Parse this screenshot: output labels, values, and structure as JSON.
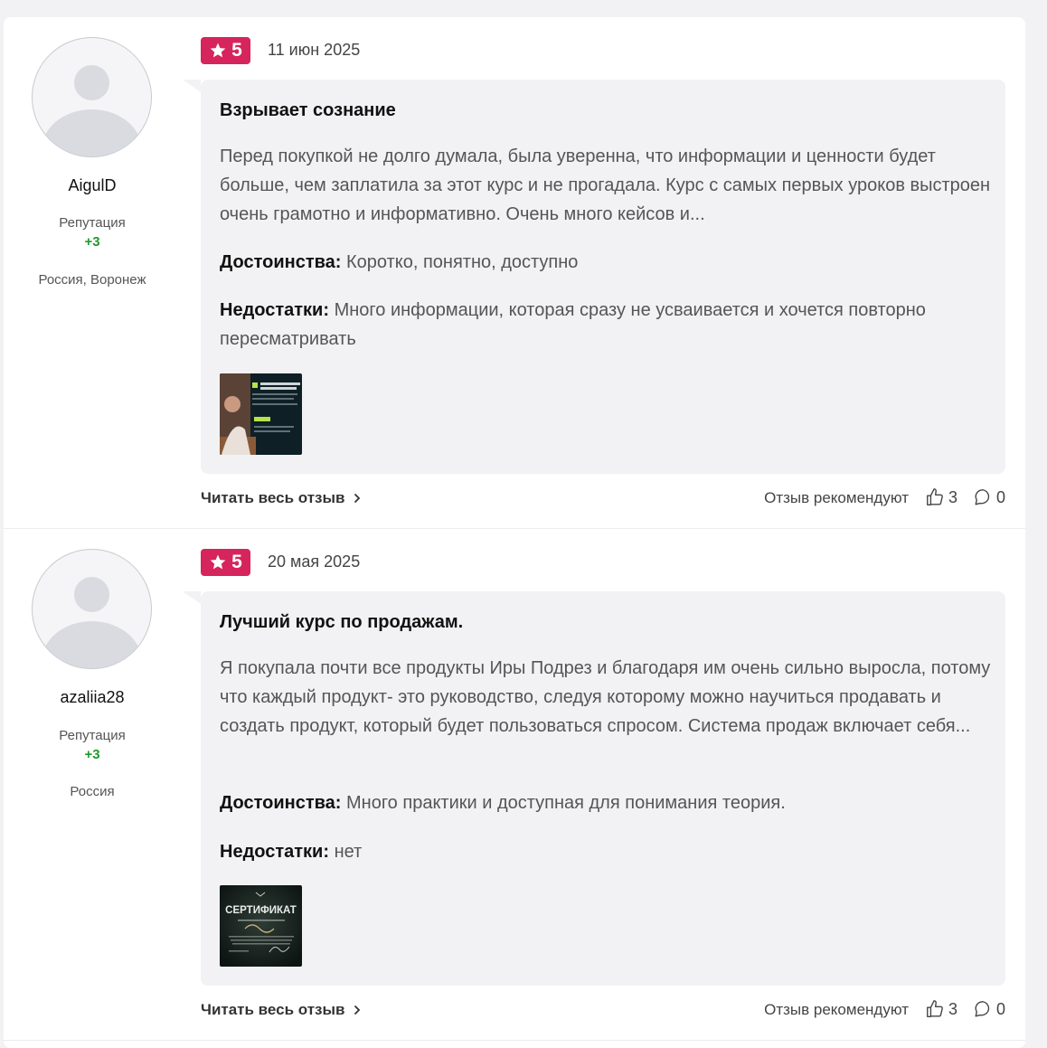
{
  "reviews": [
    {
      "author": {
        "name": "AigulD",
        "reputation_label": "Репутация",
        "reputation_value": "+3",
        "location": "Россия, Воронеж"
      },
      "rating": "5",
      "date": "11 июн 2025",
      "title": "Взрывает сознание",
      "text": "Перед покупкой не долго думала, была уверенна, что информации и ценности будет больше, чем заплатила за этот курс и не прогадала. Курс с самых первых уроков выстроен очень грамотно и информативно. Очень много кейсов и...",
      "pros_label": "Достоинства:",
      "pros": "Коротко, понятно, доступно",
      "cons_label": "Недостатки:",
      "cons": "Много информации, которая сразу не усваивается и хочется повторно пересматривать",
      "read_more": "Читать весь отзыв",
      "recommend_label": "Отзыв рекомендуют",
      "likes": "3",
      "comments": "0"
    },
    {
      "author": {
        "name": "azaliia28",
        "reputation_label": "Репутация",
        "reputation_value": "+3",
        "location": "Россия"
      },
      "rating": "5",
      "date": "20 мая 2025",
      "title": "Лучший курс по продажам.",
      "text": "Я покупала почти все продукты Иры Подрез и благодаря им очень сильно выросла, потому что каждый продукт- это руководство, следуя которому можно научиться продавать и создать продукт, который будет пользоваться спросом. Система продаж включает себя...",
      "pros_label": "Достоинства:",
      "pros": "Много практики и доступная для понимания теория.",
      "cons_label": "Недостатки:",
      "cons": "нет",
      "thumb_text": "СЕРТИФИКАТ",
      "read_more": "Читать весь отзыв",
      "recommend_label": "Отзыв рекомендуют",
      "likes": "3",
      "comments": "0"
    }
  ],
  "colors": {
    "rating_bg": "#d6245d",
    "reputation": "#1f9a2c",
    "bubble_bg": "#f2f2f4"
  }
}
